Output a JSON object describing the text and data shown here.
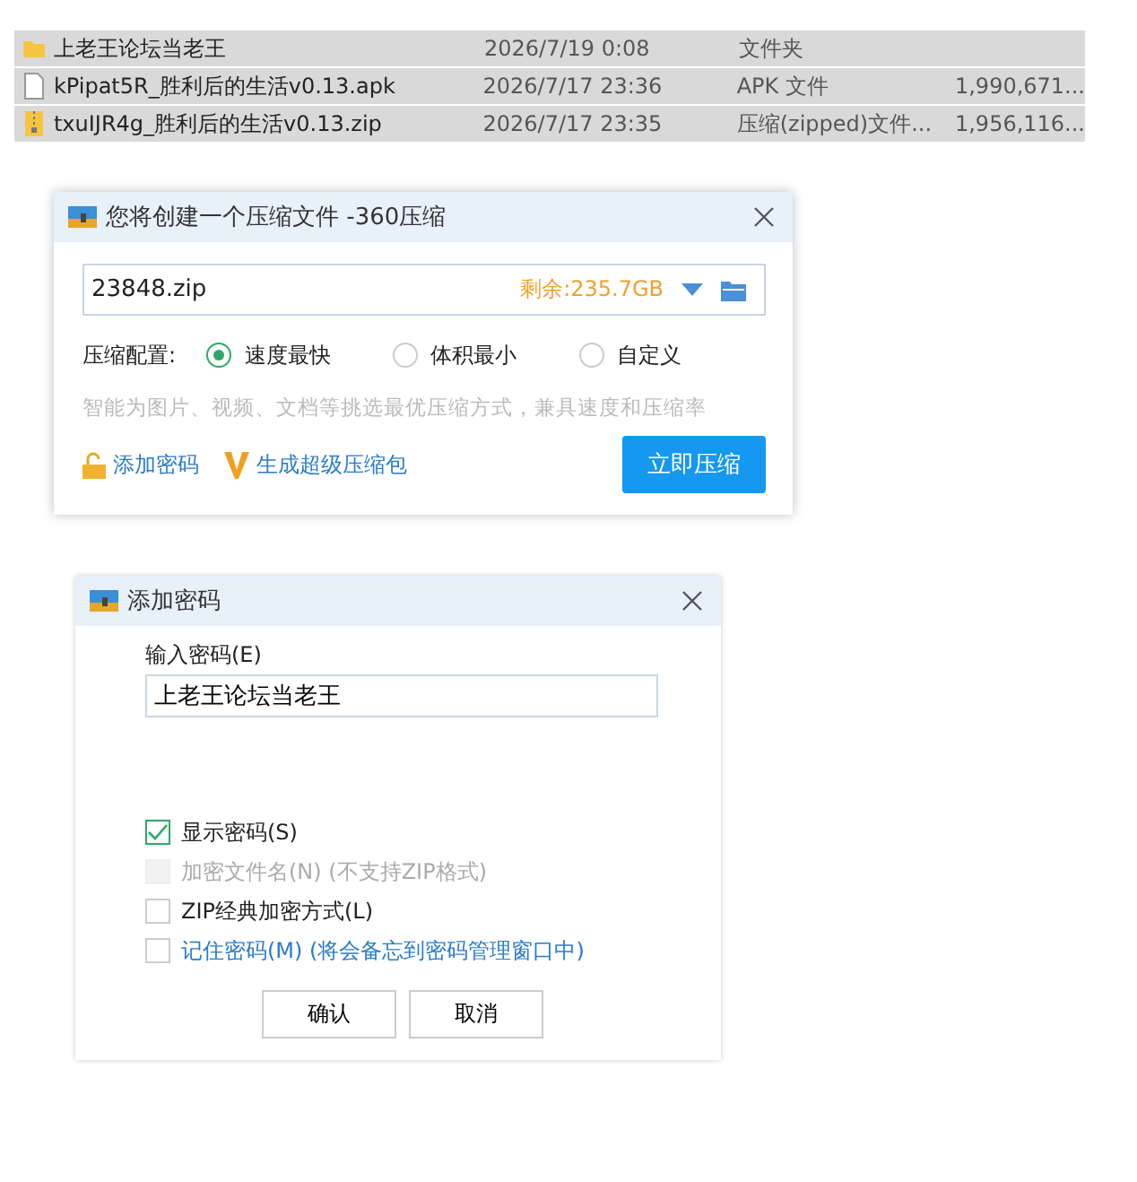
{
  "file_list": {
    "rows": [
      {
        "kind": "folder",
        "selected": true,
        "name": "上老王论坛当老王",
        "date": "2026/7/19 0:08",
        "type": "文件夹"
      },
      {
        "kind": "file",
        "selected": true,
        "name": "kPipat5R_胜利后的生活v0.13.apk",
        "date": "2026/7/17 23:36",
        "type": "APK 文件",
        "size": "1,990,671..."
      },
      {
        "kind": "zip",
        "selected": true,
        "name": "txuIJR4g_胜利后的生活v0.13.zip",
        "date": "2026/7/17 23:35",
        "type": "压缩(zipped)文件...",
        "size": "1,956,116..."
      }
    ]
  },
  "compress_dialog": {
    "title": "您将创建一个压缩文件 -360压缩",
    "filename": "23848.zip",
    "free_space": "剩余:235.7GB",
    "config_label": "压缩配置:",
    "options": [
      {
        "label": "速度最快",
        "selected": true
      },
      {
        "label": "体积最小",
        "selected": false
      },
      {
        "label": "自定义",
        "selected": false
      }
    ],
    "hint": "智能为图片、视频、文档等挑选最优压缩方式，兼具速度和压缩率",
    "add_password": "添加密码",
    "super_package": "生成超级压缩包",
    "compress_button": "立即压缩"
  },
  "password_dialog": {
    "title": "添加密码",
    "password_label": "输入密码(E)",
    "password_value": "上老王论坛当老王",
    "options": [
      {
        "kind": "plain",
        "label": "显示密码(S)",
        "checked": true,
        "disabled": false
      },
      {
        "kind": "plain",
        "label": "加密文件名(N) (不支持ZIP格式)",
        "checked": false,
        "disabled": true
      },
      {
        "kind": "plain",
        "label": "ZIP经典加密方式(L)",
        "checked": false,
        "disabled": false
      },
      {
        "kind": "link",
        "label": "记住密码(M) (将会备忘到密码管理窗口中)",
        "checked": false,
        "disabled": false
      }
    ],
    "buttons": [
      "确认",
      "取消"
    ]
  }
}
